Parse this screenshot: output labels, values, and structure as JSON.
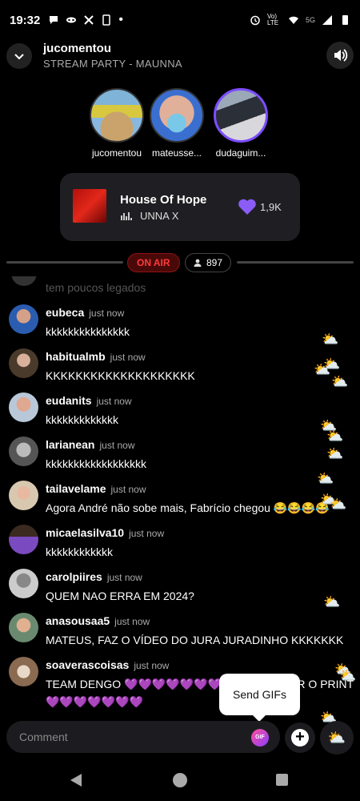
{
  "status_bar": {
    "time": "19:32",
    "left_icons": [
      "chat-bubble-icon",
      "mask-icon",
      "x-icon",
      "device-icon",
      "dot-icon"
    ],
    "network": "5G",
    "volte": "Vo) LTE"
  },
  "header": {
    "title": "jucomentou",
    "subtitle": "STREAM PARTY - MAUNNA"
  },
  "participants": [
    {
      "name": "jucomentou"
    },
    {
      "name": "mateusse..."
    },
    {
      "name": "dudaguim..."
    }
  ],
  "now_playing": {
    "title": "House Of Hope",
    "artist": "UNNA X",
    "likes": "1,9K"
  },
  "live": {
    "badge": "ON AIR",
    "listeners": "897"
  },
  "chat": {
    "faded_text": "tem poucos legados",
    "messages": [
      {
        "user": "eubeca",
        "time": "just now",
        "text": "kkkkkkkkkkkkkkk"
      },
      {
        "user": "habitualmb",
        "time": "just now",
        "text": "KKKKKKKKKKKKKKKKKKKK"
      },
      {
        "user": "eudanits",
        "time": "just now",
        "text": "kkkkkkkkkkkkk"
      },
      {
        "user": "larianean",
        "time": "just now",
        "text": "kkkkkkkkkkkkkkkkkk"
      },
      {
        "user": "tailavelame",
        "time": "just now",
        "text": "Agora André não sobe mais, Fabrício chegou 😂😂😂😂"
      },
      {
        "user": "micaelasilva10",
        "time": "just now",
        "text": "kkkkkkkkkkkk"
      },
      {
        "user": "carolpiires",
        "time": "just now",
        "text": "QUEM NAO ERRA EM 2024?"
      },
      {
        "user": "anasousaa5",
        "time": "just now",
        "text": "MATEUS, FAZ O VÍDEO DO JURA JURADINHO KKKKKKK"
      },
      {
        "user": "soaverascoisas",
        "time": "just now",
        "text": "TEAM DENGO 💜💜💜💜💜💜💜 VAMOS BOTAR O PRINT 💜💜💜💜💜💜💜"
      }
    ]
  },
  "tooltip": {
    "label": "Send GIFs"
  },
  "compose": {
    "placeholder": "Comment",
    "gif_label": "GIF",
    "plus_label": "+"
  },
  "reaction_emoji": "⛅",
  "colors": {
    "accent": "#7c4dff",
    "on_air": "#ff3b3b",
    "background": "#000000"
  }
}
